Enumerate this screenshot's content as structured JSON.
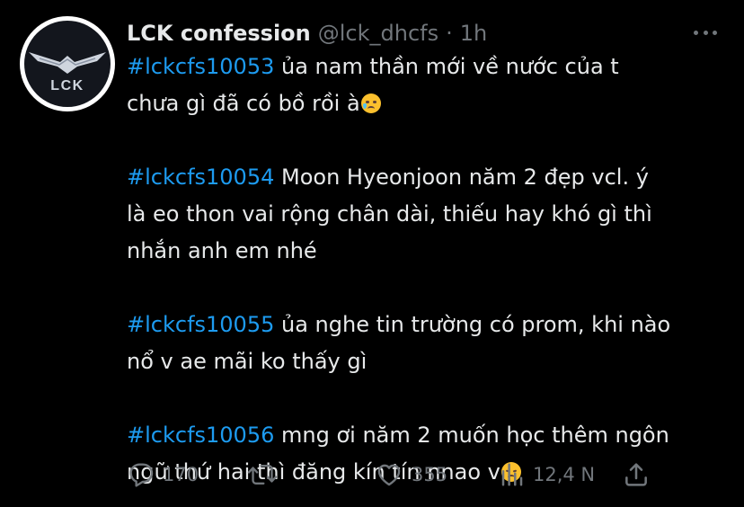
{
  "tweet": {
    "author": {
      "display_name": "LCK confession",
      "handle": "@lck_dhcfs",
      "separator": "·",
      "time": "1h",
      "avatar_text": "LCK"
    },
    "paragraphs": [
      {
        "hashtag": "#lckcfs10053",
        "lines": [
          " ủa nam thần mới về nước của t",
          "chưa gì đã có bồ rồi à"
        ],
        "emoji": "crying-face-emoji"
      },
      {
        "hashtag": "#lckcfs10054",
        "lines": [
          " Moon Hyeonjoon năm 2 đẹp vcl. ý",
          "là eo thon vai rộng chân dài, thiếu hay khó gì thì",
          "nhắn anh em nhé"
        ]
      },
      {
        "hashtag": "#lckcfs10055",
        "lines": [
          " ủa nghe tin trường có prom, khi nào",
          "nổ v ae mãi ko thấy gì"
        ]
      },
      {
        "hashtag": "#lckcfs10056",
        "lines": [
          " mng ơi năm 2 muốn học thêm ngôn",
          "ngữ thứ hai thì đăng kín tín nnao v"
        ],
        "emoji": "disappointed-face-emoji"
      }
    ],
    "actions": {
      "replies": "170",
      "retweets": "",
      "likes": "355",
      "views": "12,4 N"
    },
    "icons": [
      "reply-icon",
      "retweet-icon",
      "like-icon",
      "views-icon",
      "share-icon",
      "more-icon"
    ]
  },
  "colors": {
    "background": "#000000",
    "text": "#e7e9ea",
    "secondary": "#71767b",
    "link": "#1d9bf0"
  }
}
